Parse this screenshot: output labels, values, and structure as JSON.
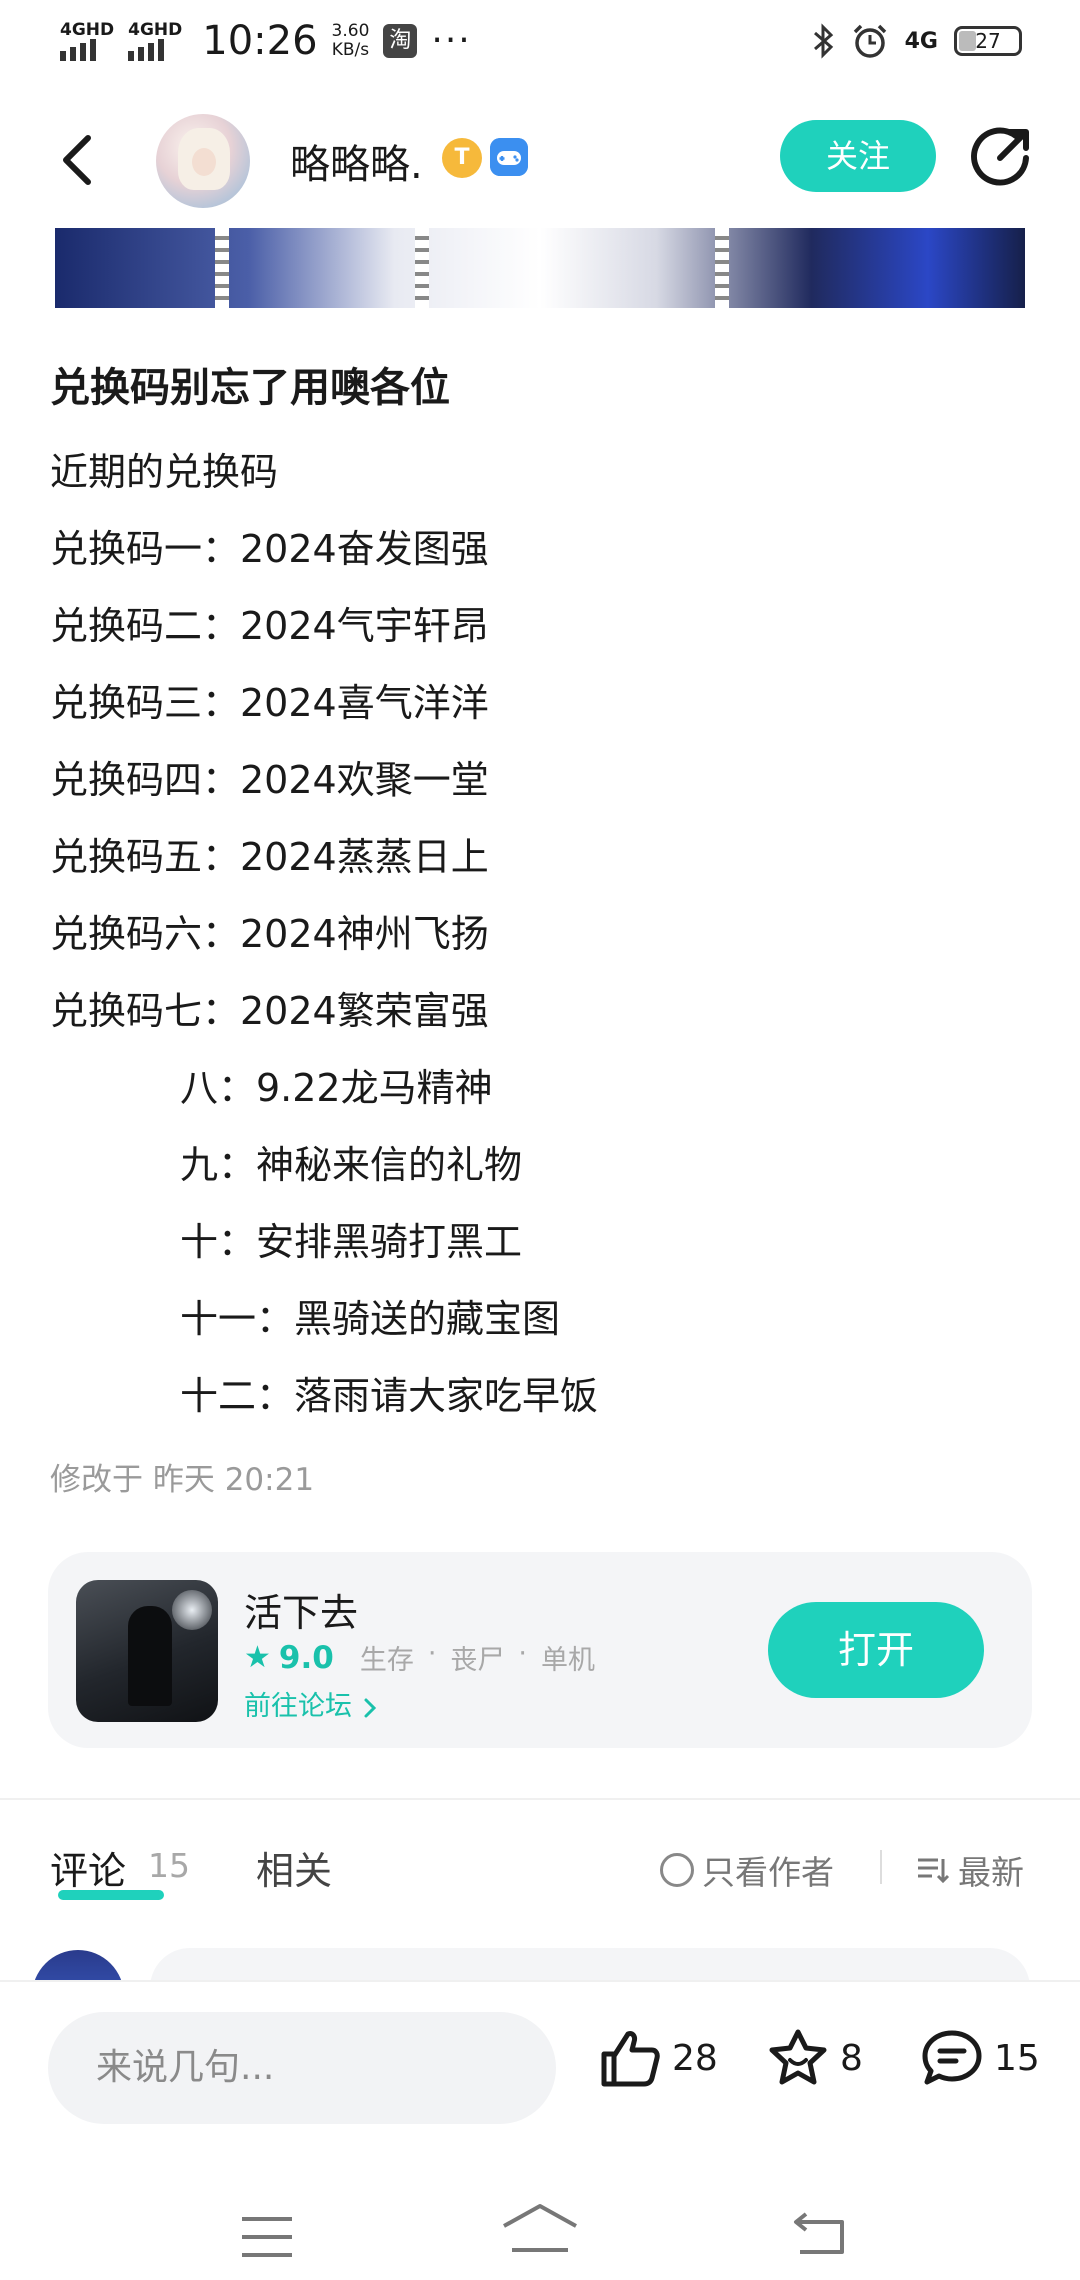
{
  "status_bar": {
    "signal1_label": "4GHD",
    "signal2_label": "4GHD",
    "time": "10:26",
    "speed_value": "3.60",
    "speed_unit": "KB/s",
    "app_icon": "淘",
    "more": "···",
    "network": "4G",
    "battery": "27"
  },
  "header": {
    "username": "略略略.",
    "badge_t": "T",
    "follow_label": "关注"
  },
  "post": {
    "title": "兑换码别忘了用噢各位",
    "lines": [
      "近期的兑换码",
      "兑换码一：2024奋发图强",
      "兑换码二：2024气宇轩昂",
      "兑换码三：2024喜气洋洋",
      "兑换码四：2024欢聚一堂",
      "兑换码五：2024蒸蒸日上",
      "兑换码六：2024神州飞扬",
      "兑换码七：2024繁荣富强"
    ],
    "indented_lines": [
      "八：9.22龙马精神",
      "九：神秘来信的礼物",
      "十：安排黑骑打黑工",
      "十一：黑骑送的藏宝图",
      "十二：落雨请大家吃早饭"
    ],
    "edit_time": "修改于 昨天 20:21"
  },
  "game_card": {
    "name": "活下去",
    "score": "9.0",
    "tags": [
      "生存",
      "·",
      "丧尸",
      "·",
      "单机"
    ],
    "forum_link": "前往论坛",
    "open_label": "打开"
  },
  "tabs": {
    "comment_label": "评论",
    "comment_count": "15",
    "related_label": "相关",
    "author_only_label": "只看作者",
    "sort_label": "最新"
  },
  "bottom_bar": {
    "input_placeholder": "来说几句...",
    "like_count": "28",
    "favorite_count": "8",
    "comment_count": "15"
  },
  "colors": {
    "accent": "#1fd1bc",
    "muted_text": "#9a9a9a"
  }
}
